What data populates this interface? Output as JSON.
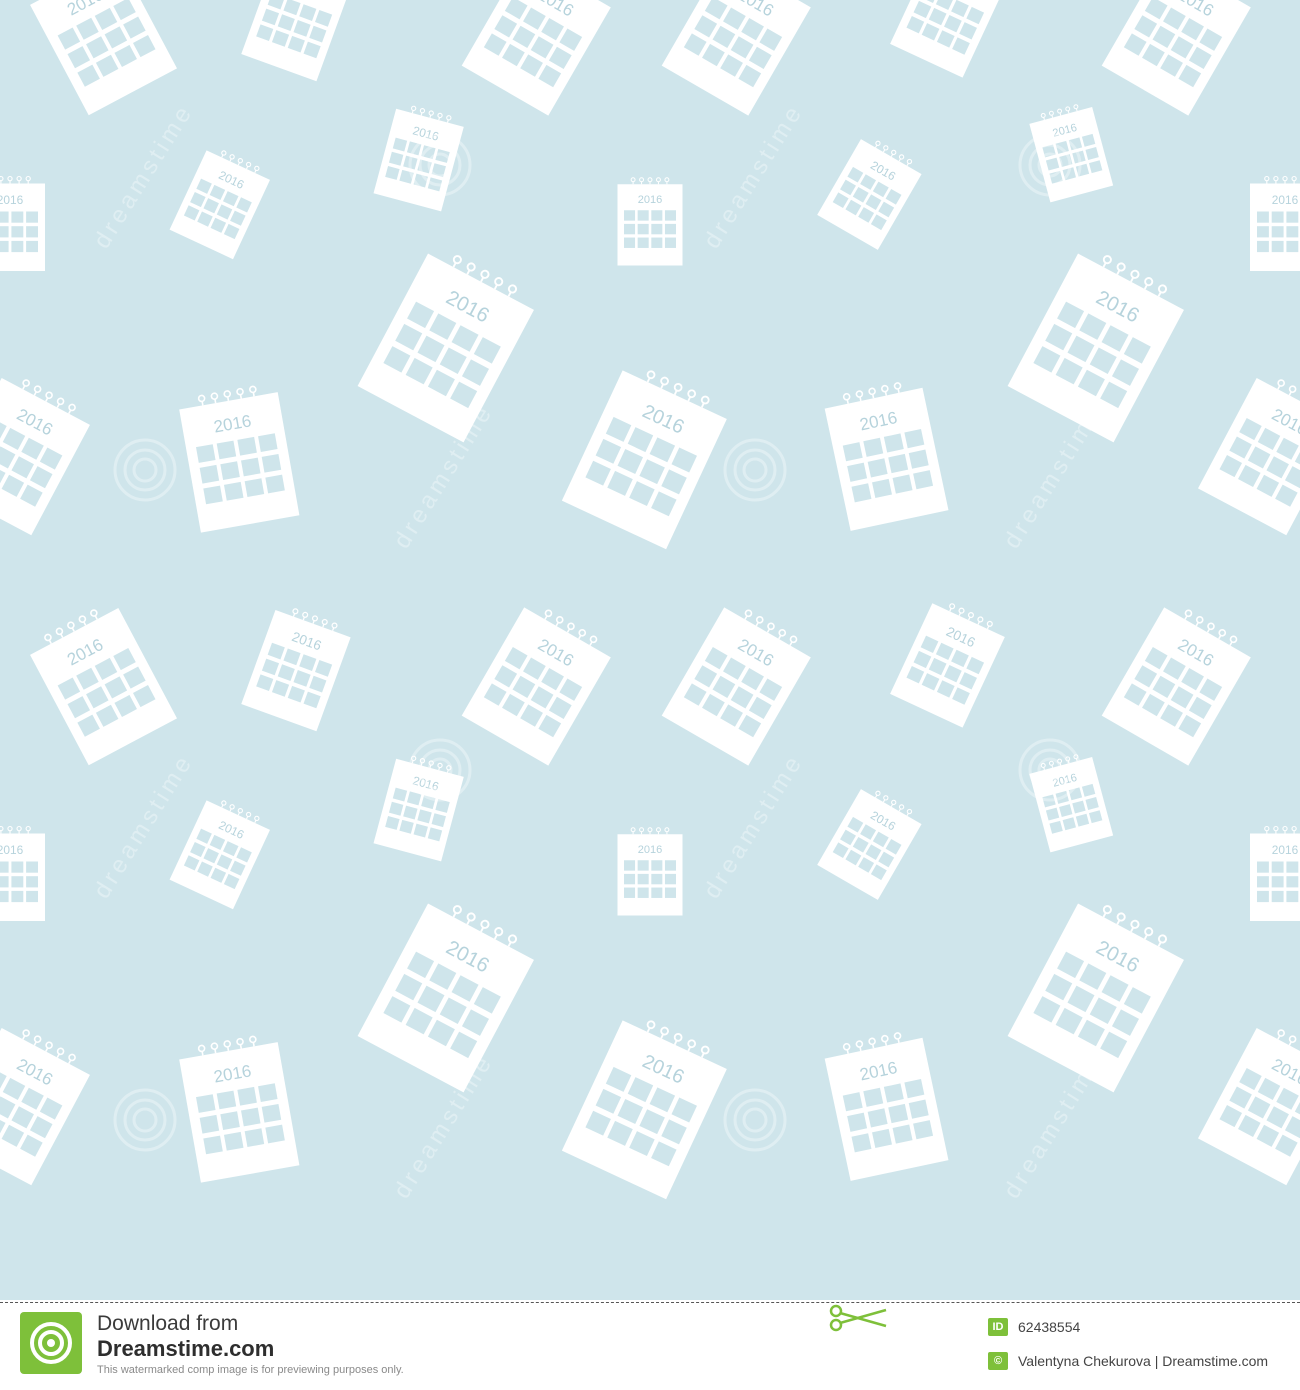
{
  "pattern": {
    "background_color": "#cfe5eb",
    "calendar_color": "#ffffff",
    "calendar_year": "2016",
    "watermark_text": "dreamstime",
    "icon": "calendar-2016-icon"
  },
  "footer": {
    "line1": "Download from",
    "line2": "Dreamstime.com",
    "note": "This watermarked comp image is for previewing purposes only.",
    "id_badge": "ID",
    "image_id": "62438554",
    "credit_badge": "©",
    "credit": "Valentyna Chekurova | Dreamstime.com",
    "accent_color": "#7ec03a"
  }
}
